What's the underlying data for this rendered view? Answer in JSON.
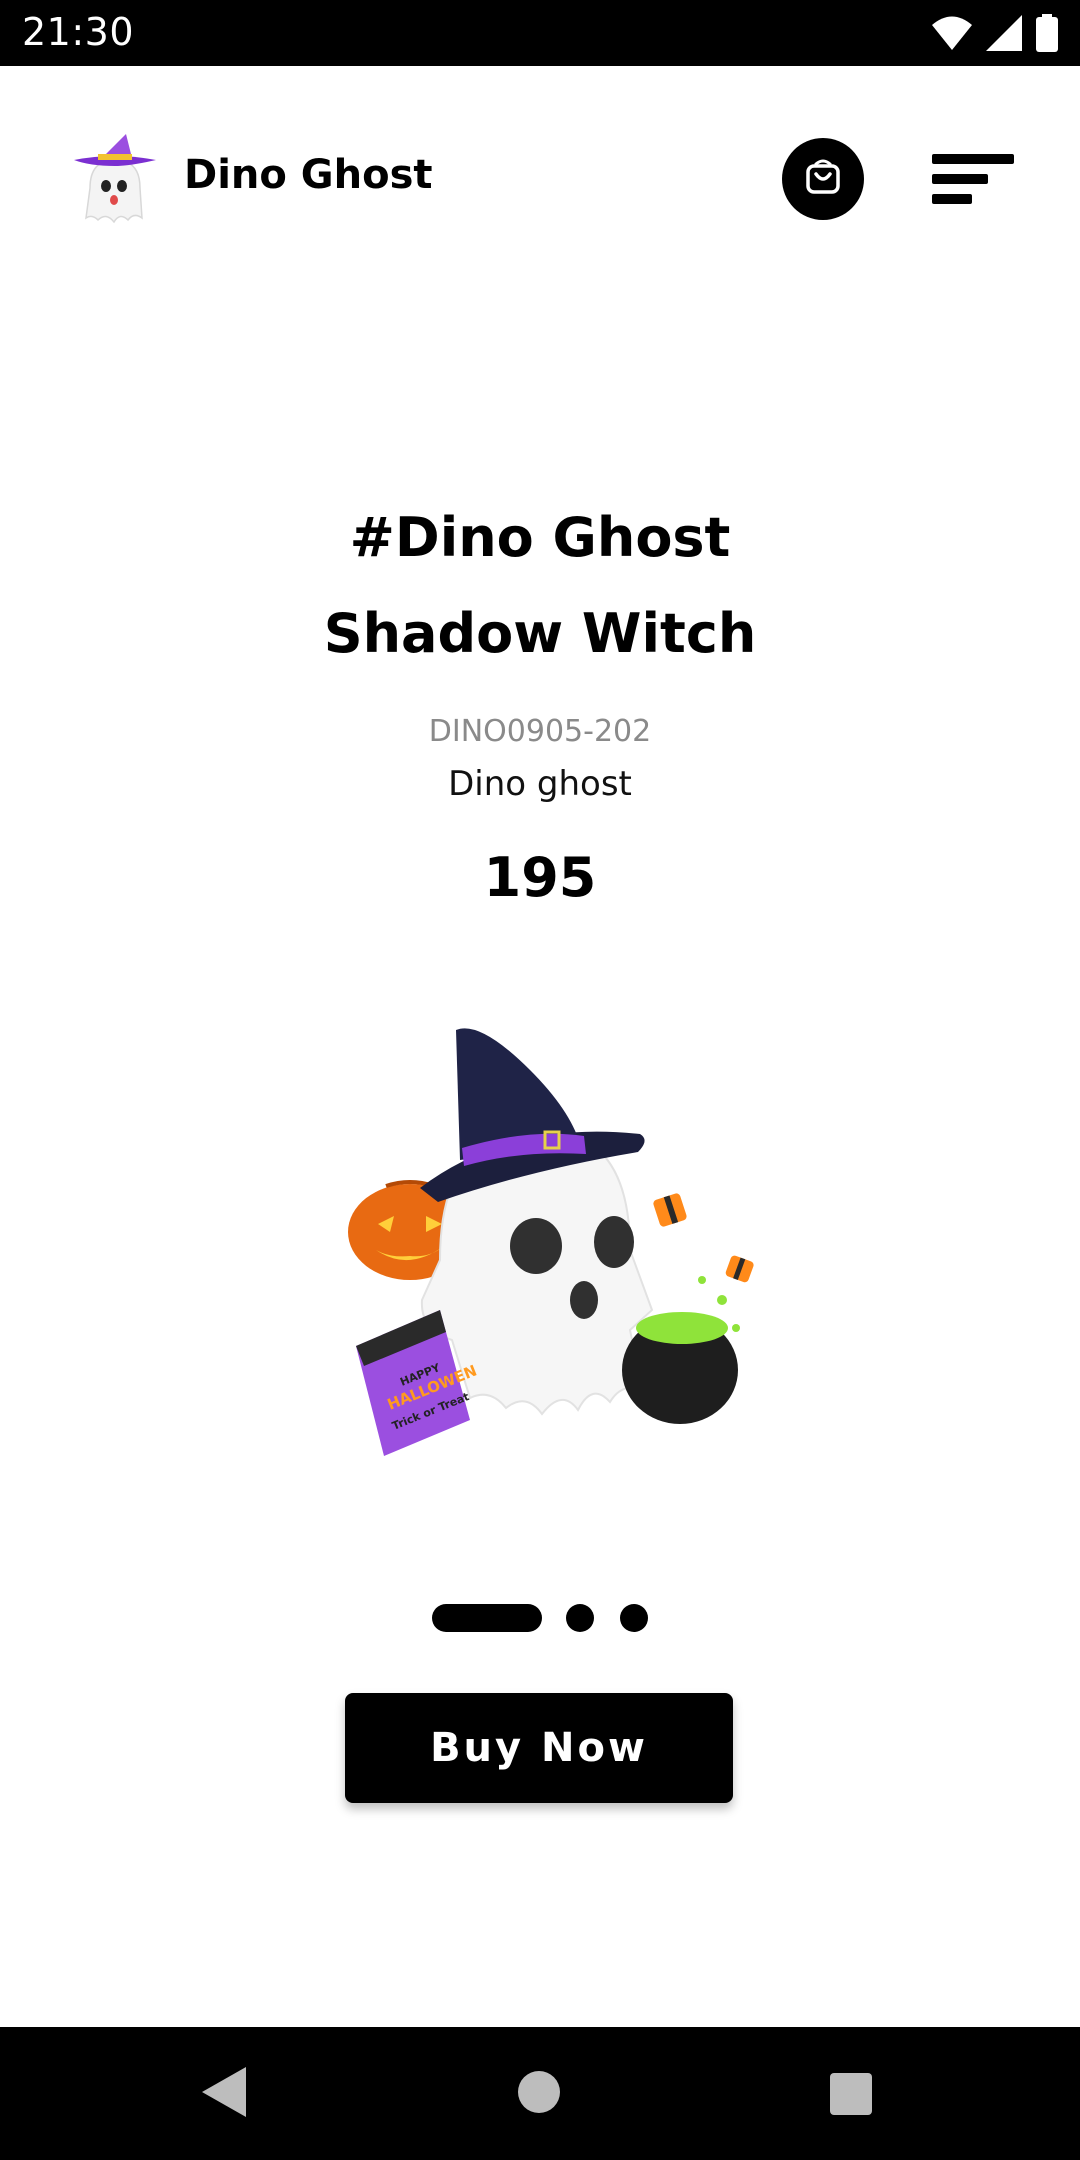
{
  "status_bar": {
    "time": "21:30",
    "icons": [
      "wifi-icon",
      "cellular-signal-icon",
      "battery-icon"
    ]
  },
  "header": {
    "brand": "Dino Ghost",
    "logo_icon": "ghost-witch-logo-icon",
    "cart_icon": "shopping-bag-icon",
    "menu_icon": "menu-icon"
  },
  "product": {
    "title_line1": "#Dino Ghost",
    "title_line2": "Shadow Witch",
    "sku": "DINO0905-202",
    "subtitle": "Dino ghost",
    "price": "195",
    "image": "ghost-witch-halloween-illustration",
    "calendar_text": {
      "line1": "HAPPY",
      "line2": "HALLOWEN",
      "line3": "Trick or Treat"
    }
  },
  "pager": {
    "count": 3,
    "active_index": 0
  },
  "actions": {
    "buy_label": "Buy Now"
  },
  "nav": {
    "icons": [
      "back-icon",
      "home-icon",
      "recents-icon"
    ]
  },
  "colors": {
    "background": "#ffffff",
    "primary": "#000000",
    "sku_text": "#8a8a8a",
    "hat_band": "#8b3fd9",
    "pumpkin": "#e86a12",
    "calendar": "#9b4fe0",
    "potion": "#8fe33a"
  }
}
